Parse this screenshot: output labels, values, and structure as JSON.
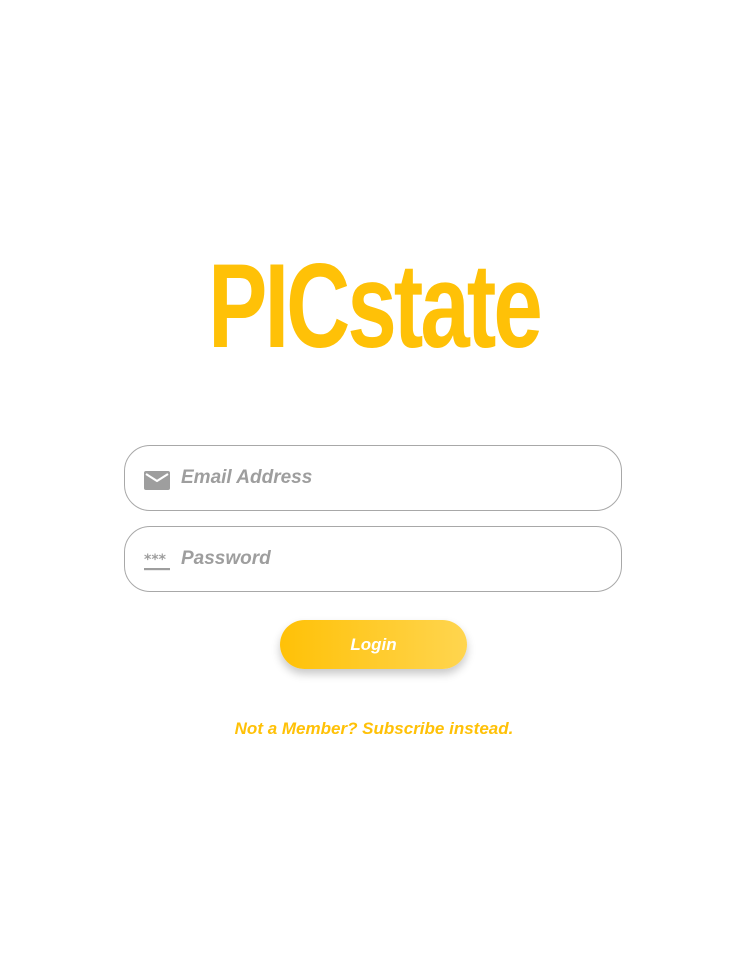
{
  "brand": {
    "logo_text": "PICstate",
    "color": "#FFC107"
  },
  "login_form": {
    "email": {
      "placeholder": "Email Address",
      "value": "",
      "icon": "mail-icon"
    },
    "password": {
      "placeholder": "Password",
      "value": "",
      "icon": "password-icon"
    },
    "login_button_label": "Login",
    "subscribe_link_text": "Not a Member? Subscribe instead."
  },
  "colors": {
    "accent": "#FFC107",
    "field_border": "#a8a8a8",
    "placeholder": "#9e9e9e",
    "icon": "#9e9e9e"
  }
}
